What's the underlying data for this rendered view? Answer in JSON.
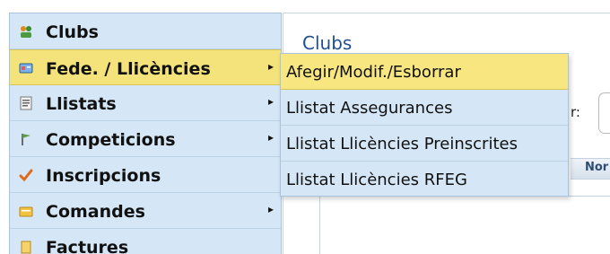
{
  "page": {
    "title": "Clubs",
    "filter_label": "r:",
    "grid_header": "Nor"
  },
  "menu": {
    "items": [
      {
        "label": "Clubs",
        "icon": "users-icon",
        "has_submenu": false
      },
      {
        "label": "Fede. / Llicències",
        "icon": "card-icon",
        "has_submenu": true,
        "active": true
      },
      {
        "label": "Llistats",
        "icon": "list-icon",
        "has_submenu": true
      },
      {
        "label": "Competicions",
        "icon": "flag-icon",
        "has_submenu": true
      },
      {
        "label": "Inscripcions",
        "icon": "check-icon",
        "has_submenu": false
      },
      {
        "label": "Comandes",
        "icon": "cart-icon",
        "has_submenu": true
      },
      {
        "label": "Factures",
        "icon": "invoice-icon",
        "has_submenu": false
      }
    ]
  },
  "submenu": {
    "items": [
      {
        "label": "Afegir/Modif./Esborrar",
        "active": true
      },
      {
        "label": "Llistat Assegurances"
      },
      {
        "label": "Llistat Llicències Preinscrites"
      },
      {
        "label": "Llistat Llicències RFEG"
      }
    ]
  },
  "colors": {
    "menu_bg": "#d5e6f6",
    "highlight": "#f3e37a",
    "title": "#1f4f8f"
  }
}
